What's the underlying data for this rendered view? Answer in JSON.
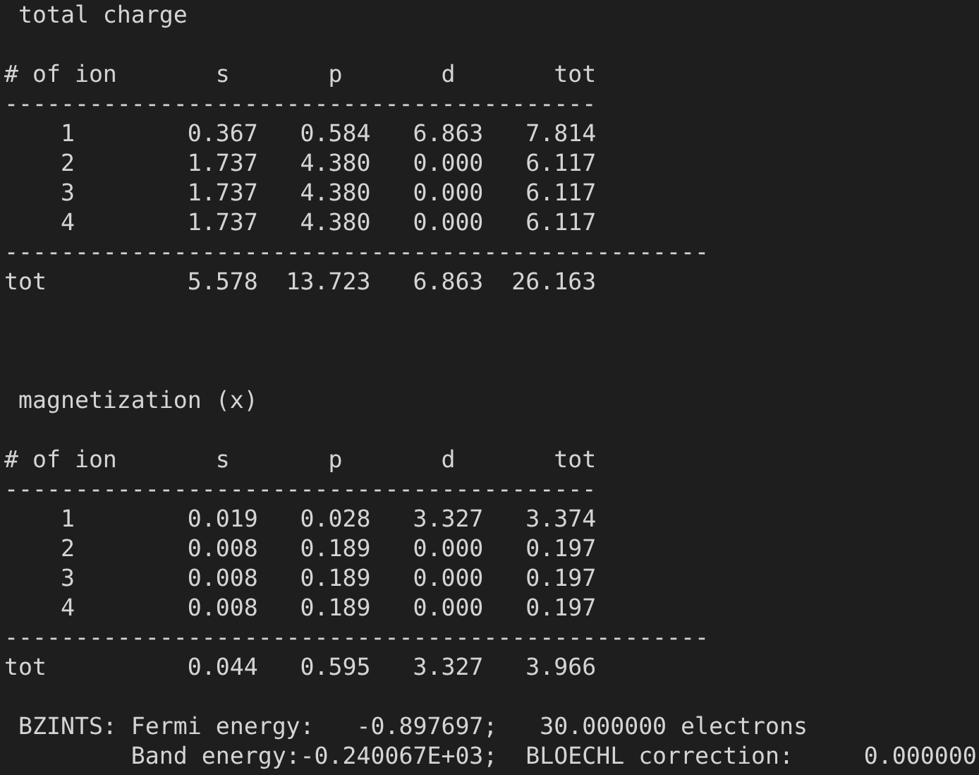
{
  "terminal": {
    "lines": [
      {
        "kind": "text",
        "text": " total charge"
      },
      {
        "kind": "blank"
      },
      {
        "kind": "text",
        "text": "# of ion       s       p       d       tot"
      },
      {
        "kind": "text",
        "text": "------------------------------------------"
      },
      {
        "kind": "text",
        "text": "    1        0.367   0.584   6.863   7.814"
      },
      {
        "kind": "text",
        "text": "    2        1.737   4.380   0.000   6.117"
      },
      {
        "kind": "text",
        "text": "    3        1.737   4.380   0.000   6.117"
      },
      {
        "kind": "text",
        "text": "    4        1.737   4.380   0.000   6.117"
      },
      {
        "kind": "text",
        "text": "--------------------------------------------------"
      },
      {
        "kind": "text",
        "text": "tot          5.578  13.723   6.863  26.163"
      },
      {
        "kind": "blank"
      },
      {
        "kind": "blank"
      },
      {
        "kind": "blank"
      },
      {
        "kind": "text",
        "text": " magnetization (x)"
      },
      {
        "kind": "blank"
      },
      {
        "kind": "text",
        "text": "# of ion       s       p       d       tot"
      },
      {
        "kind": "text",
        "text": "------------------------------------------"
      },
      {
        "kind": "text",
        "text": "    1        0.019   0.028   3.327   3.374"
      },
      {
        "kind": "text",
        "text": "    2        0.008   0.189   0.000   0.197"
      },
      {
        "kind": "text",
        "text": "    3        0.008   0.189   0.000   0.197"
      },
      {
        "kind": "text",
        "text": "    4        0.008   0.189   0.000   0.197"
      },
      {
        "kind": "text",
        "text": "--------------------------------------------------"
      },
      {
        "kind": "text",
        "text": "tot          0.044   0.595   3.327   3.966"
      },
      {
        "kind": "blank"
      },
      {
        "kind": "text",
        "text": " BZINTS: Fermi energy:   -0.897697;   30.000000 electrons"
      },
      {
        "kind": "text",
        "text": "         Band energy:-0.240067E+03;  BLOECHL correction:     0.000000"
      }
    ]
  }
}
